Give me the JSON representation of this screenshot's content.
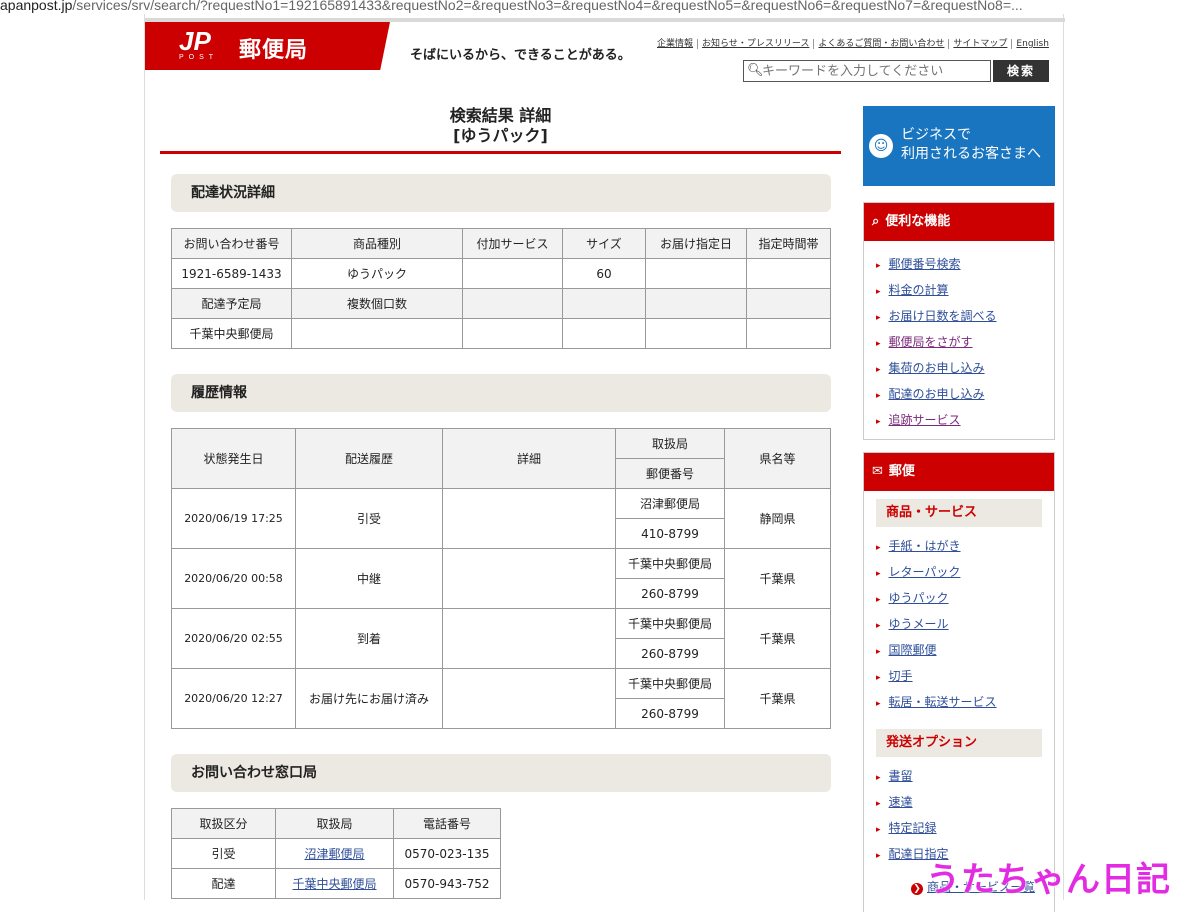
{
  "browser": {
    "url_host": "apanpost.jp",
    "url_rest": "/services/srv/search/?requestNo1=192165891433&requestNo2=&requestNo3=&requestNo4=&requestNo5=&requestNo6=&requestNo7=&requestNo8=..."
  },
  "header": {
    "logo_mark": "JP",
    "logo_post": "POST",
    "logo_name": "郵便局",
    "tagline": "そばにいるから、できることがある。",
    "links": [
      "企業情報",
      "お知らせ・プレスリリース",
      "よくあるご質問・お問い合わせ",
      "サイトマップ",
      "English"
    ],
    "search_placeholder": "キーワードを入力してください",
    "search_button": "検索"
  },
  "title": {
    "line1": "検索結果 詳細",
    "line2": "[ゆうパック]"
  },
  "delivery_status": {
    "heading": "配達状況詳細",
    "header_row1": [
      "お問い合わせ番号",
      "商品種別",
      "付加サービス",
      "サイズ",
      "お届け指定日",
      "指定時間帯"
    ],
    "row1": [
      "1921-6589-1433",
      "ゆうパック",
      "",
      "60",
      "",
      ""
    ],
    "header_row2": [
      "配達予定局",
      "複数個口数",
      "",
      "",
      "",
      ""
    ],
    "row2": [
      "千葉中央郵便局",
      "",
      "",
      "",
      "",
      ""
    ]
  },
  "history": {
    "heading": "履歴情報",
    "headers": {
      "date": "状態発生日",
      "status": "配送履歴",
      "detail": "詳細",
      "office": "取扱局",
      "postal": "郵便番号",
      "pref": "県名等"
    },
    "rows": [
      {
        "date": "2020/06/19 17:25",
        "status": "引受",
        "detail": "",
        "office": "沼津郵便局",
        "postal": "410-8799",
        "pref": "静岡県"
      },
      {
        "date": "2020/06/20 00:58",
        "status": "中継",
        "detail": "",
        "office": "千葉中央郵便局",
        "postal": "260-8799",
        "pref": "千葉県"
      },
      {
        "date": "2020/06/20 02:55",
        "status": "到着",
        "detail": "",
        "office": "千葉中央郵便局",
        "postal": "260-8799",
        "pref": "千葉県"
      },
      {
        "date": "2020/06/20 12:27",
        "status": "お届け先にお届け済み",
        "detail": "",
        "office": "千葉中央郵便局",
        "postal": "260-8799",
        "pref": "千葉県"
      }
    ]
  },
  "contact": {
    "heading": "お問い合わせ窓口局",
    "headers": [
      "取扱区分",
      "取扱局",
      "電話番号"
    ],
    "rows": [
      {
        "kind": "引受",
        "office": "沼津郵便局",
        "phone": "0570-023-135"
      },
      {
        "kind": "配達",
        "office": "千葉中央郵便局",
        "phone": "0570-943-752"
      }
    ]
  },
  "sidebar": {
    "business_line1": "ビジネスで",
    "business_line2": "利用されるお客さまへ",
    "tools_heading": "便利な機能",
    "tools": [
      "郵便番号検索",
      "料金の計算",
      "お届け日数を調べる",
      "郵便局をさがす",
      "集荷のお申し込み",
      "配達のお申し込み",
      "追跡サービス"
    ],
    "mail_heading": "郵便",
    "products_heading": "商品・サービス",
    "products": [
      "手紙・はがき",
      "レターパック",
      "ゆうパック",
      "ゆうメール",
      "国際郵便",
      "切手",
      "転居・転送サービス"
    ],
    "options_heading": "発送オプション",
    "options": [
      "書留",
      "速達",
      "特定記録",
      "配達日指定"
    ],
    "more_link": "商品・サービス一覧"
  },
  "watermark": "うたちゃん日記",
  "colors": {
    "brand_red": "#cc0000",
    "business_blue": "#1a75c0",
    "link": "#2f4f9a",
    "watermark": "#e22be2"
  }
}
